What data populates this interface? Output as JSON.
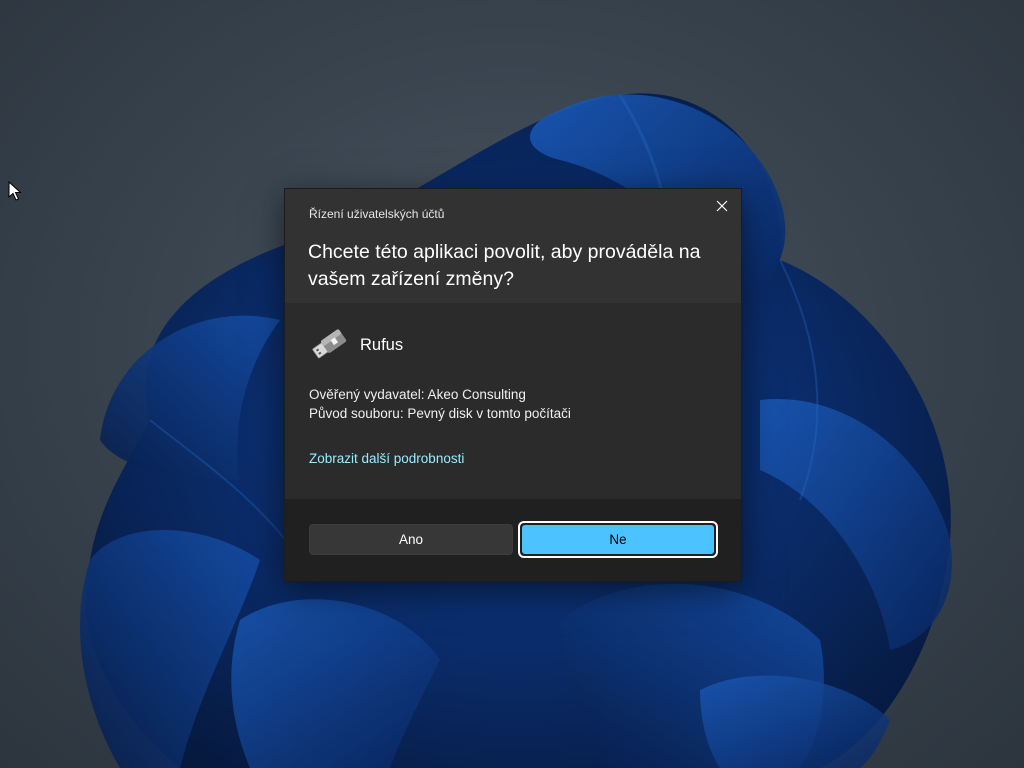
{
  "desktop": {
    "wallpaper_icon": "windows-bloom-wallpaper",
    "cursor_icon": "arrow-pointer-icon"
  },
  "dialog": {
    "caption": "Řízení uživatelských účtů",
    "question": "Chcete této aplikaci povolit, aby prováděla na vašem zařízení změny?",
    "close_icon": "close-icon",
    "app": {
      "name": "Rufus",
      "icon": "usb-drive-icon"
    },
    "publisher_line": "Ověřený vydavatel: Akeo Consulting",
    "origin_line": "Původ souboru: Pevný disk v tomto počítači",
    "details_link": "Zobrazit další podrobnosti",
    "yes_label": "Ano",
    "no_label": "Ne"
  },
  "colors": {
    "accent": "#4cc2ff",
    "link": "#99ebff",
    "dialog_bg": "#2b2b2b",
    "footer_bg": "#202020"
  }
}
